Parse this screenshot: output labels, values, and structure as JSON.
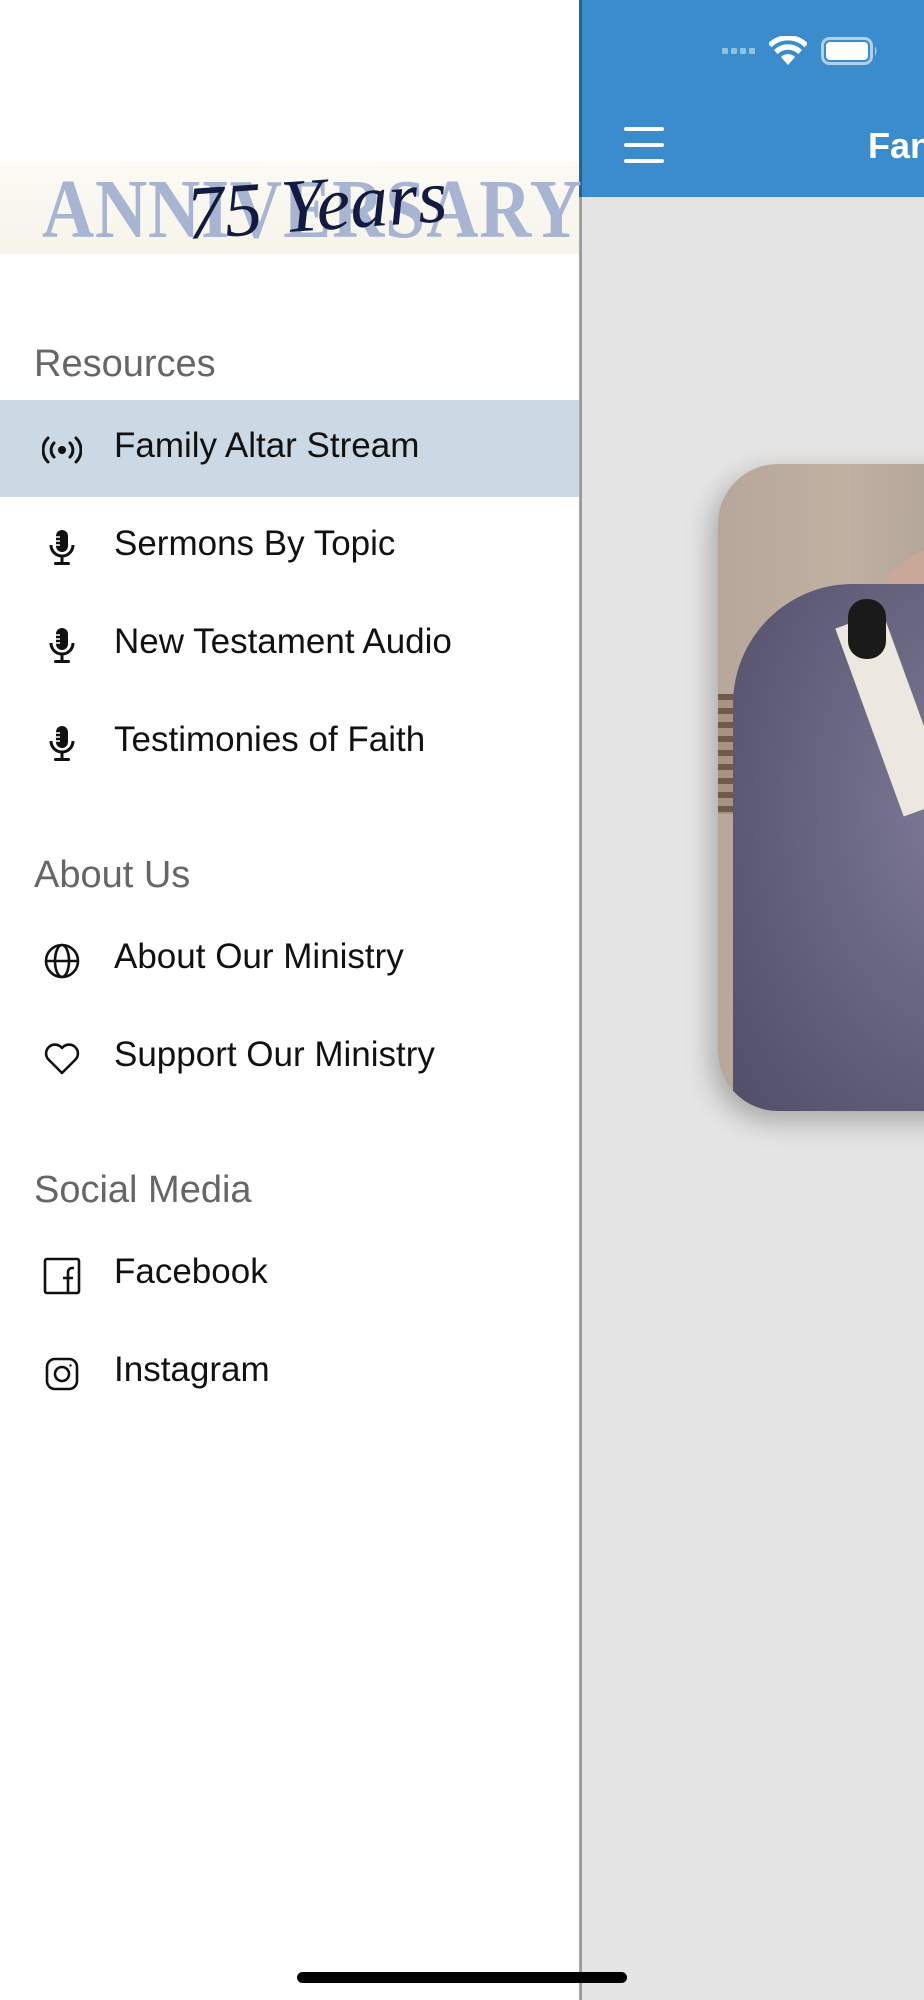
{
  "header": {
    "title": "Fan",
    "menu_icon": "hamburger-menu-icon",
    "background_color": "#3a8ccc"
  },
  "status_bar": {
    "icons": [
      "cellular-signal-icon",
      "wifi-icon",
      "battery-icon"
    ]
  },
  "logo": {
    "word": "ANNIVERSARY",
    "script": "75 Years"
  },
  "drawer": {
    "sections": [
      {
        "title": "Resources",
        "items": [
          {
            "label": "Family Altar Stream",
            "icon": "broadcast-icon",
            "active": true
          },
          {
            "label": "Sermons By Topic",
            "icon": "microphone-icon"
          },
          {
            "label": "New Testament Audio",
            "icon": "microphone-icon"
          },
          {
            "label": "Testimonies of Faith",
            "icon": "microphone-icon"
          }
        ]
      },
      {
        "title": "About Us",
        "items": [
          {
            "label": "About Our Ministry",
            "icon": "globe-icon"
          },
          {
            "label": "Support Our Ministry",
            "icon": "heart-icon"
          }
        ]
      },
      {
        "title": "Social Media",
        "items": [
          {
            "label": "Facebook",
            "icon": "facebook-icon"
          },
          {
            "label": "Instagram",
            "icon": "instagram-icon"
          }
        ]
      }
    ],
    "active_background": "#cbd9e4"
  }
}
